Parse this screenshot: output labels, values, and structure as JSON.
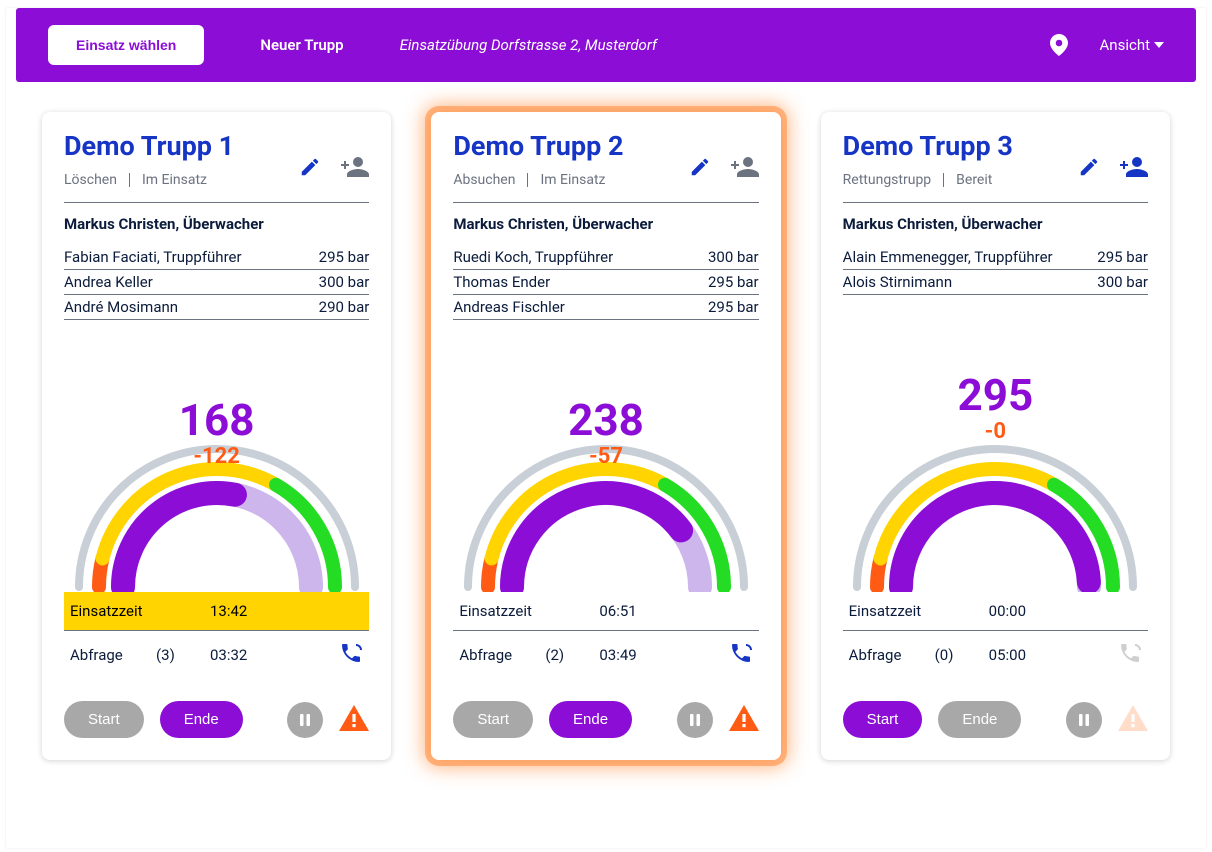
{
  "header": {
    "choose_mission": "Einsatz wählen",
    "new_trupp": "Neuer Trupp",
    "mission_name": "Einsatzübung Dorfstrasse 2, Musterdorf",
    "view": "Ansicht"
  },
  "labels": {
    "einsatzzeit": "Einsatzzeit",
    "abfrage": "Abfrage",
    "start": "Start",
    "ende": "Ende"
  },
  "trupps": [
    {
      "title": "Demo Trupp 1",
      "task": "Löschen",
      "status": "Im Einsatz",
      "supervisor": "Markus Christen, Überwacher",
      "members": [
        {
          "name": "Fabian Faciati, Truppführer",
          "pressure": "295 bar"
        },
        {
          "name": "Andrea Keller",
          "pressure": "300 bar"
        },
        {
          "name": "André Mosimann",
          "pressure": "290 bar"
        }
      ],
      "gauge": {
        "value": "168",
        "delta": "-122",
        "fill_deg": 101
      },
      "einsatzzeit": "13:42",
      "einsatz_yellow": true,
      "abfrage_count": "(3)",
      "abfrage_time": "03:32",
      "phone_active": true,
      "start_enabled": false,
      "ende_enabled": true,
      "alert_on": true,
      "glow": false
    },
    {
      "title": "Demo Trupp 2",
      "task": "Absuchen",
      "status": "Im Einsatz",
      "supervisor": "Markus Christen, Überwacher",
      "members": [
        {
          "name": "Ruedi Koch, Truppführer",
          "pressure": "300 bar"
        },
        {
          "name": "Thomas Ender",
          "pressure": "295 bar"
        },
        {
          "name": "Andreas Fischler",
          "pressure": "295 bar"
        }
      ],
      "gauge": {
        "value": "238",
        "delta": "-57",
        "fill_deg": 143
      },
      "einsatzzeit": "06:51",
      "einsatz_yellow": false,
      "abfrage_count": "(2)",
      "abfrage_time": "03:49",
      "phone_active": true,
      "start_enabled": false,
      "ende_enabled": true,
      "alert_on": true,
      "glow": true
    },
    {
      "title": "Demo Trupp 3",
      "task": "Rettungstrupp",
      "status": "Bereit",
      "supervisor": "Markus Christen, Überwacher",
      "members": [
        {
          "name": "Alain Emmenegger, Truppführer",
          "pressure": "295 bar"
        },
        {
          "name": "Alois Stirnimann",
          "pressure": "300 bar"
        }
      ],
      "gauge": {
        "value": "295",
        "delta": "-0",
        "fill_deg": 177
      },
      "einsatzzeit": "00:00",
      "einsatz_yellow": false,
      "abfrage_count": "(0)",
      "abfrage_time": "05:00",
      "phone_active": false,
      "start_enabled": true,
      "ende_enabled": false,
      "alert_on": false,
      "glow": false
    }
  ]
}
